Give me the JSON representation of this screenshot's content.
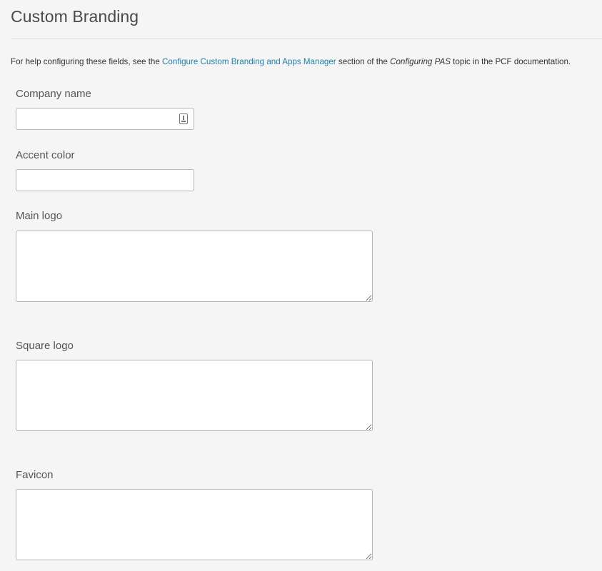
{
  "page": {
    "title": "Custom Branding"
  },
  "help": {
    "prefix": "For help configuring these fields, see the ",
    "link_text": "Configure Custom Branding and Apps Manager",
    "middle": " section of the ",
    "topic": "Configuring PAS",
    "suffix": " topic in the PCF documentation."
  },
  "fields": {
    "company_name": {
      "label": "Company name",
      "value": ""
    },
    "accent_color": {
      "label": "Accent color",
      "value": ""
    },
    "main_logo": {
      "label": "Main logo",
      "value": ""
    },
    "square_logo": {
      "label": "Square logo",
      "value": ""
    },
    "favicon": {
      "label": "Favicon",
      "value": ""
    }
  },
  "icons": {
    "company_name_field_icon": "contact-card-icon"
  },
  "colors": {
    "background": "#f5f5f5",
    "link": "#1f7fa6",
    "input_border": "#b5b5b5"
  }
}
